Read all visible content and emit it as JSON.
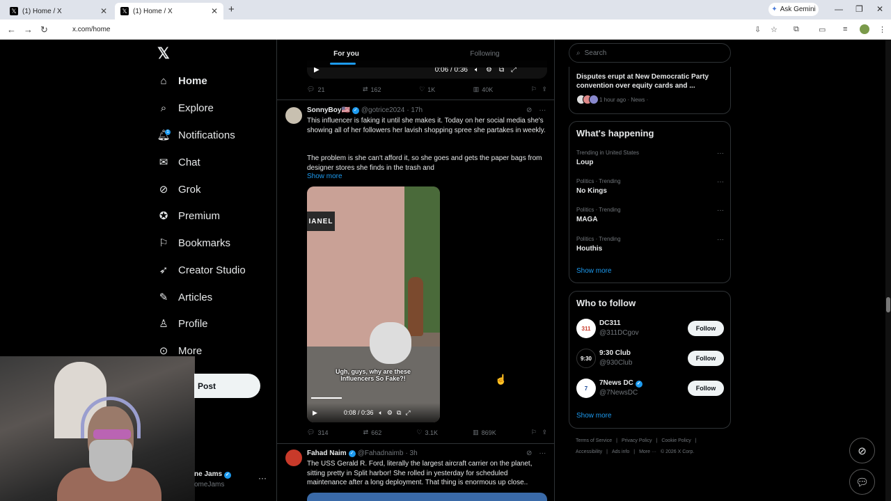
{
  "browser": {
    "tabs": [
      {
        "title": "(1) Home / X"
      },
      {
        "title": "(1) Home / X"
      }
    ],
    "gemini_label": "Ask Gemini",
    "url": "x.com/home"
  },
  "nav": {
    "items": [
      {
        "label": "Home"
      },
      {
        "label": "Explore"
      },
      {
        "label": "Notifications"
      },
      {
        "label": "Chat"
      },
      {
        "label": "Grok"
      },
      {
        "label": "Premium"
      },
      {
        "label": "Bookmarks"
      },
      {
        "label": "Creator Studio"
      },
      {
        "label": "Articles"
      },
      {
        "label": "Profile"
      },
      {
        "label": "More"
      }
    ],
    "notif_count": "1",
    "post_label": "Post",
    "account_name": "ne Jams",
    "account_handle": "omeJams"
  },
  "feed": {
    "tabs": [
      {
        "label": "For you"
      },
      {
        "label": "Following"
      }
    ],
    "prev_tweet": {
      "video_time": "0:06 / 0:36",
      "replies": "21",
      "reposts": "162",
      "likes": "1K",
      "views": "40K"
    },
    "tweet1": {
      "name": "SonnyBoy🇺🇸",
      "handle": "@gotrice2024",
      "time": "· 17h",
      "text1": "This influencer is faking it until she makes it. Today on her social media she's showing all of her followers her lavish shopping spree she partakes in weekly.",
      "text2": "The problem is she can't afford it, so she goes and gets the paper bags from designer stores she finds in the trash and",
      "show_more": "Show more",
      "sign_text": "IANEL",
      "caption": "Ugh, guys, why are these Influencers So Fake?!",
      "video_time": "0:08 / 0:36",
      "replies": "314",
      "reposts": "662",
      "likes": "3.1K",
      "views": "869K"
    },
    "tweet2": {
      "name": "Fahad Naim",
      "handle": "@Fahadnaimb",
      "time": "· 3h",
      "text": "The USS Gerald R. Ford, literally the largest aircraft carrier on the planet, sitting pretty in Split harbor! She rolled in yesterday for scheduled maintenance after a long deployment. That thing is enormous up close.."
    }
  },
  "right": {
    "search_placeholder": "Search",
    "news": {
      "title": "Disputes erupt at New Democratic Party convention over equity cards and ...",
      "meta": "1 hour ago · News ·"
    },
    "happening": {
      "title": "What's happening",
      "trends": [
        {
          "context": "Trending in United States",
          "topic": "Loup"
        },
        {
          "context": "Politics · Trending",
          "topic": "No Kings"
        },
        {
          "context": "Politics · Trending",
          "topic": "MAGA"
        },
        {
          "context": "Politics · Trending",
          "topic": "Houthis"
        }
      ],
      "show_more": "Show more"
    },
    "who_to_follow": {
      "title": "Who to follow",
      "accounts": [
        {
          "name": "DC311",
          "handle": "@311DCgov",
          "follow": "Follow",
          "avatar_text": "311"
        },
        {
          "name": "9:30 Club",
          "handle": "@930Club",
          "follow": "Follow",
          "avatar_text": "9:30"
        },
        {
          "name": "7News DC",
          "handle": "@7NewsDC",
          "follow": "Follow",
          "avatar_text": "7"
        }
      ],
      "show_more": "Show more"
    },
    "footer": {
      "row1": [
        "Terms of Service",
        "|",
        "Privacy Policy",
        "|",
        "Cookie Policy",
        "|"
      ],
      "row2": [
        "Accessibility",
        "|",
        "Ads info",
        "|",
        "More ···",
        "© 2026 X Corp."
      ]
    }
  },
  "colors": {
    "accent": "#1d9bf0",
    "bg": "#000000",
    "border": "#2f3336",
    "muted": "#71767b"
  }
}
